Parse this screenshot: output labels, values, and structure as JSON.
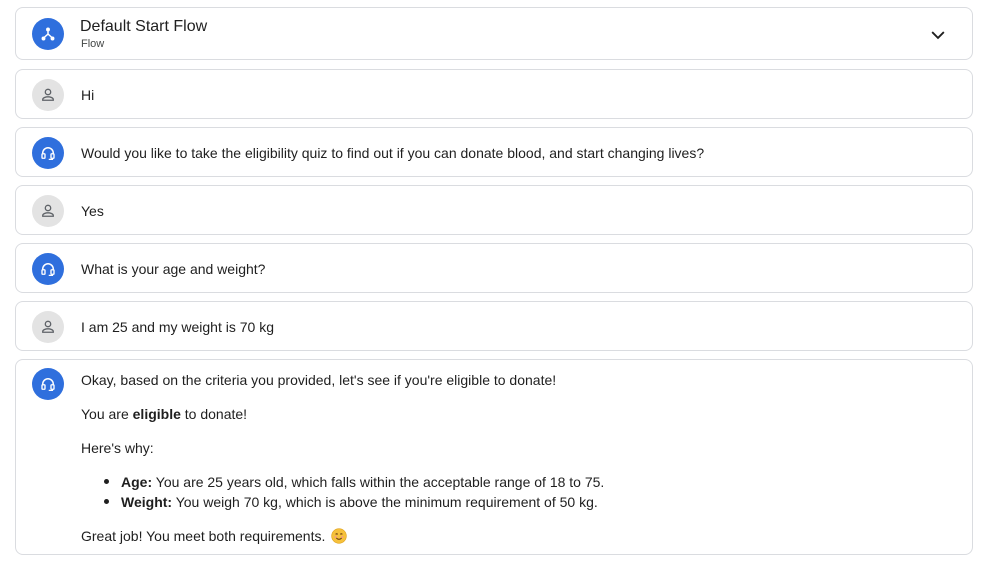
{
  "flow": {
    "title": "Default Start Flow",
    "subtitle": "Flow",
    "icon": "flow-icon",
    "toggle_icon": "chevron-down-icon"
  },
  "turns": [
    {
      "role": "user",
      "icon": "person-icon",
      "text": "Hi"
    },
    {
      "role": "agent",
      "icon": "headset-icon",
      "text": "Would you like to take the eligibility quiz to find out if you can donate blood, and start changing lives?"
    },
    {
      "role": "user",
      "icon": "person-icon",
      "text": "Yes"
    },
    {
      "role": "agent",
      "icon": "headset-icon",
      "text": "What is your age and weight?"
    },
    {
      "role": "user",
      "icon": "person-icon",
      "text": "I am 25 and my weight is 70 kg"
    }
  ],
  "final_response": {
    "icon": "headset-icon",
    "intro": "Okay, based on the criteria you provided, let's see if you're eligible to donate!",
    "result_prefix": "You are ",
    "result_bold": "eligible",
    "result_suffix": " to donate!",
    "why": "Here's why:",
    "bullets": [
      {
        "label": "Age:",
        "text": " You are 25 years old, which falls within the acceptable range of 18 to 75."
      },
      {
        "label": "Weight:",
        "text": " You weigh 70 kg, which is above the minimum requirement of 50 kg."
      }
    ],
    "closing": "Great job! You meet both requirements.",
    "emoji": "smiling-face-icon"
  },
  "colors": {
    "agent_avatar": "#2f6fdd",
    "user_avatar": "#e3e3e3",
    "border": "#dadce0"
  }
}
